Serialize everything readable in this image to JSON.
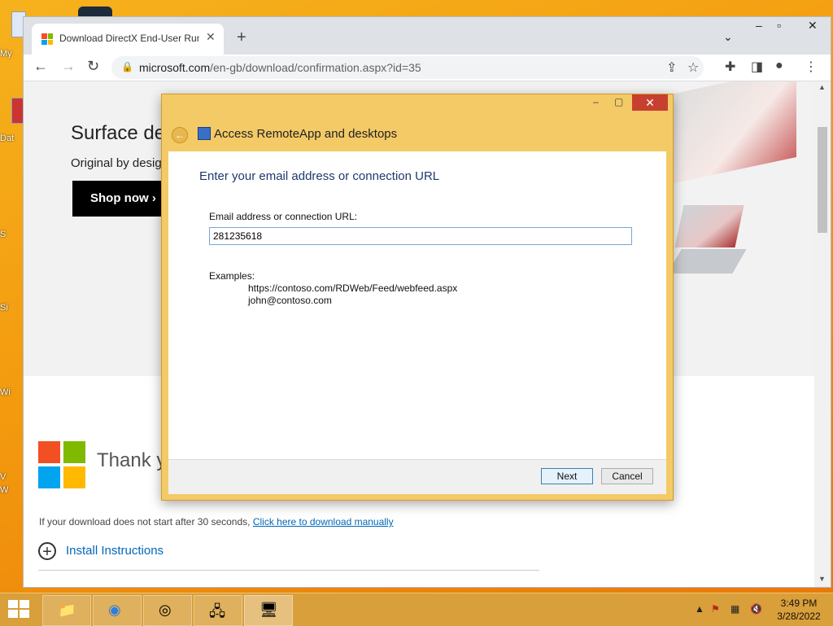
{
  "desktop": {
    "labels": [
      "My",
      "Dat",
      "S",
      "Si",
      "Wi",
      "V",
      "W"
    ]
  },
  "browser": {
    "tab_title": "Download DirectX End-User Runt",
    "url_host": "microsoft.com",
    "url_path": "/en-gb/download/confirmation.aspx?id=35"
  },
  "page": {
    "hero_title": "Surface dev",
    "hero_subtitle": "Original by desig",
    "shop_button": "Shop now",
    "thank_you": "Thank yo",
    "download_notice": "If your download does not start after 30 seconds,",
    "download_link": "Click here to download manually",
    "install_instructions": "Install Instructions"
  },
  "dialog": {
    "title": "Access RemoteApp and desktops",
    "heading": "Enter your email address or connection URL",
    "field_label": "Email address or connection URL:",
    "field_value": "281235618",
    "examples_label": "Examples:",
    "examples": [
      "https://contoso.com/RDWeb/Feed/webfeed.aspx",
      "john@contoso.com"
    ],
    "next_button": "Next",
    "cancel_button": "Cancel"
  },
  "taskbar": {
    "time": "3:49 PM",
    "date": "3/28/2022"
  },
  "colors": {
    "desktop": "#f39a0e",
    "dialog_frame": "#f3ca66",
    "close_button": "#c7402f",
    "link": "#0067b8"
  }
}
